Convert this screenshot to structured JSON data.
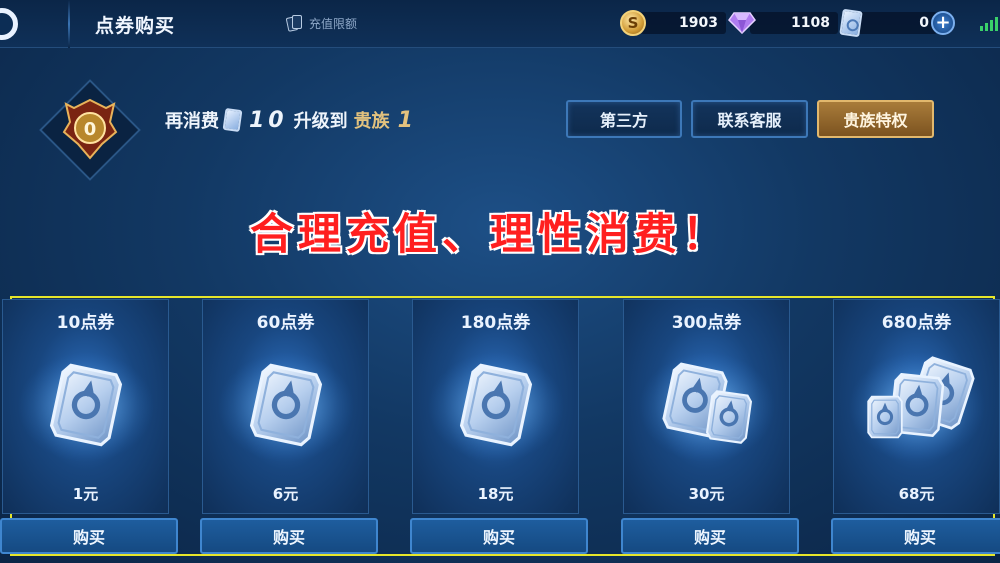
{
  "header": {
    "title": "点券购买",
    "recharge_limit_label": "充值限额",
    "currencies": {
      "gold": {
        "icon": "gold-coin-icon",
        "value": "1903"
      },
      "diamond": {
        "icon": "diamond-icon",
        "value": "1108"
      },
      "coupon": {
        "icon": "coupon-icon",
        "value": "0"
      }
    }
  },
  "vip": {
    "prefix": "再消费",
    "amount": "10",
    "middle": "升级到",
    "noble_label": "贵族",
    "noble_level": "1",
    "badge_level": "0"
  },
  "buttons": {
    "third_party": "第三方",
    "support": "联系客服",
    "noble_privilege": "贵族特权"
  },
  "slogan": "合理充值、理性消费！",
  "packages": [
    {
      "title": "10点券",
      "price": "1元",
      "buy": "购买",
      "art": "single-coupon-icon"
    },
    {
      "title": "60点券",
      "price": "6元",
      "buy": "购买",
      "art": "single-coupon-icon"
    },
    {
      "title": "180点券",
      "price": "18元",
      "buy": "购买",
      "art": "single-coupon-icon"
    },
    {
      "title": "300点券",
      "price": "30元",
      "buy": "购买",
      "art": "double-coupon-icon"
    },
    {
      "title": "680点券",
      "price": "68元",
      "buy": "购买",
      "art": "triple-coupon-icon"
    }
  ],
  "colors": {
    "highlight_border": "#e6e62a",
    "slogan_red": "#ff1f1f",
    "noble_gold": "#e3c27e"
  }
}
